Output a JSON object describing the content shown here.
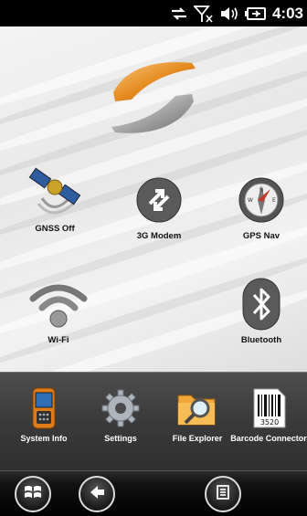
{
  "status_bar": {
    "icons": [
      "sync-arrows-icon",
      "no-signal-icon",
      "speaker-icon",
      "battery-charging-icon"
    ],
    "time": "4:03"
  },
  "home": {
    "logo": "company-logo",
    "apps": [
      {
        "label": "GNSS Off",
        "icon": "satellite-icon"
      },
      {
        "label": "3G Modem",
        "icon": "modem-sync-icon"
      },
      {
        "label": "GPS Nav",
        "icon": "compass-icon"
      },
      {
        "label": "Wi-Fi",
        "icon": "wifi-icon"
      },
      {
        "label": "Bluetooth",
        "icon": "bluetooth-icon"
      }
    ]
  },
  "dock": {
    "apps": [
      {
        "label": "System Info",
        "icon": "device-icon"
      },
      {
        "label": "Settings",
        "icon": "gear-icon"
      },
      {
        "label": "File Explorer",
        "icon": "folder-search-icon"
      },
      {
        "label": "Barcode Connector",
        "icon": "barcode-icon",
        "barcode_number": "3520"
      }
    ]
  },
  "nav_bar": {
    "buttons": [
      "windows-start-icon",
      "back-arrow-icon",
      "menu-icon"
    ]
  }
}
